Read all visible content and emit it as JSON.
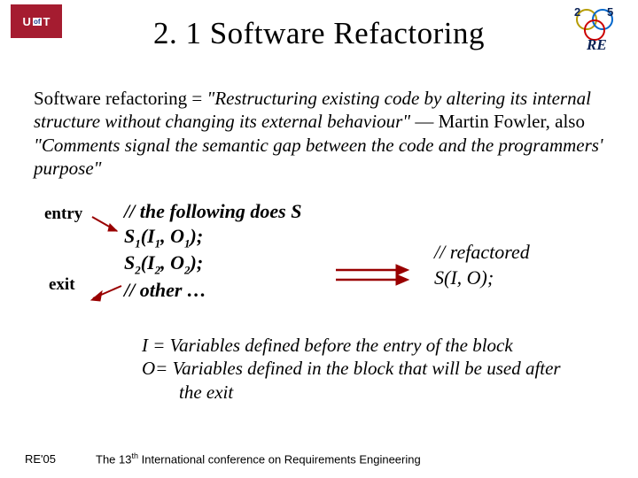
{
  "logo_left": {
    "u": "U",
    "of": "of",
    "t": "T"
  },
  "title": "2. 1 Software Refactoring",
  "definition": {
    "lead": "Software refactoring = ",
    "quote1": "\"Restructuring existing code by altering its internal structure without changing its external behaviour\"",
    "attrib": " ― Martin Fowler, also ",
    "quote2": "\"Comments signal the semantic gap between the code and the programmers' purpose\""
  },
  "diagram": {
    "entry": "entry",
    "exit": "exit",
    "code": {
      "l1": "// the following does S",
      "l2a": "S",
      "l2b": "(I",
      "l2c": ", O",
      "l2d": ");",
      "l3a": "S",
      "l3b": "(I",
      "l3c": ", O",
      "l3d": ");",
      "l4": "// other …",
      "s1": "1",
      "s2": "2"
    },
    "refactored": {
      "l1": "// refactored",
      "l2": "S(I, O);"
    }
  },
  "legend": {
    "l1": "I = Variables defined before the entry of the block",
    "l2": "O= Variables defined in the block that will be used after the exit"
  },
  "footer": {
    "conf_short": "RE'05",
    "conf_long_a": "The 13",
    "conf_long_sup": "th",
    "conf_long_b": " International conference on Requirements Engineering"
  }
}
